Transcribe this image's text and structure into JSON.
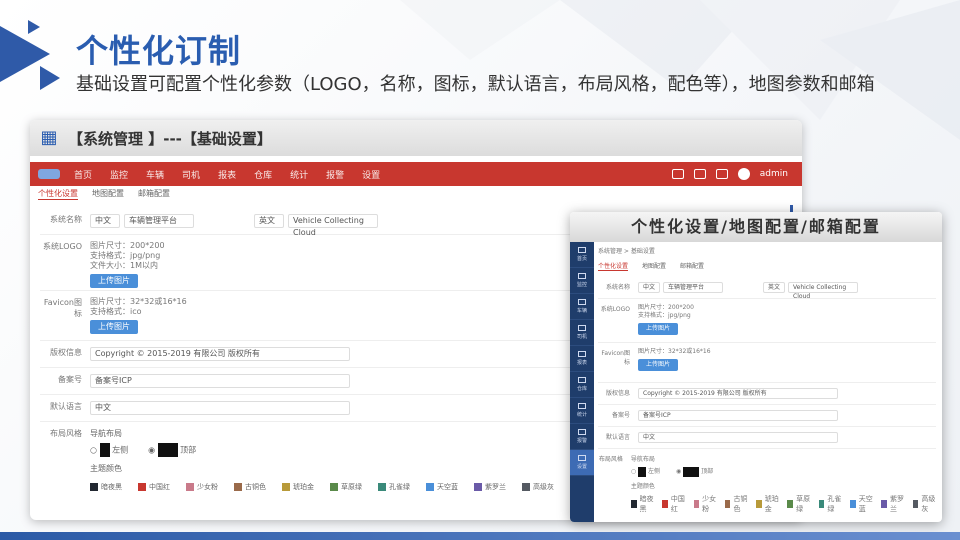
{
  "slide": {
    "title": "个性化订制",
    "subtitle": "基础设置可配置个性化参数（LOGO，名称，图标，默认语言，布局风格，配色等），地图参数和邮箱"
  },
  "main_window": {
    "header": "【系统管理 】---【基础设置】",
    "nav": {
      "items": [
        "首页",
        "监控",
        "车辆",
        "司机",
        "报表",
        "仓库",
        "统计",
        "报警",
        "设置"
      ],
      "user": "admin"
    },
    "tabs": [
      "个性化设置",
      "地图配置",
      "邮箱配置"
    ],
    "form": {
      "system_name_label": "系统名称",
      "system_name_lang": "中文",
      "system_name_value": "车辆管理平台",
      "system_name_lang2": "英文",
      "system_name_value2": "Vehicle Collecting Cloud",
      "logo_label": "系统LOGO",
      "logo_info": [
        "图片尺寸：200*200",
        "支持格式：jpg/png",
        "文件大小：1M以内"
      ],
      "logo_btn": "上传图片",
      "favicon_label": "Favicon图标",
      "favicon_info": [
        "图片尺寸：32*32或16*16",
        "支持格式：ico"
      ],
      "favicon_btn": "上传图片",
      "copyright_label": "版权信息",
      "copyright_value": "Copyright © 2015-2019 有限公司 版权所有",
      "icp_label": "备案号",
      "icp_value": "备案号ICP",
      "lang_label": "默认语言",
      "lang_value": "中文",
      "layout_label": "布局风格",
      "layout_title": "导航布局",
      "layout_opt1": "左侧",
      "layout_opt2": "顶部",
      "color_title": "主题颜色",
      "colors": [
        {
          "name": "暗夜黑",
          "hex": "#222831"
        },
        {
          "name": "中国红",
          "hex": "#c8372f"
        },
        {
          "name": "少女粉",
          "hex": "#c97a8a"
        },
        {
          "name": "古铜色",
          "hex": "#9a6a4a"
        },
        {
          "name": "琥珀金",
          "hex": "#b89a3a"
        },
        {
          "name": "草原绿",
          "hex": "#5a8a4a"
        },
        {
          "name": "孔雀绿",
          "hex": "#3a8a7a"
        },
        {
          "name": "天空蓝",
          "hex": "#4a8fd9"
        },
        {
          "name": "紫罗兰",
          "hex": "#6a5aa8"
        },
        {
          "name": "高级灰",
          "hex": "#555a62"
        }
      ]
    }
  },
  "overlay_window": {
    "header": "个性化设置/地图配置/邮箱配置",
    "breadcrumb": "系统管理 > 基础设置",
    "sidebar": [
      "首页",
      "监控",
      "车辆",
      "司机",
      "报表",
      "仓库",
      "统计",
      "报警",
      "设置"
    ]
  }
}
